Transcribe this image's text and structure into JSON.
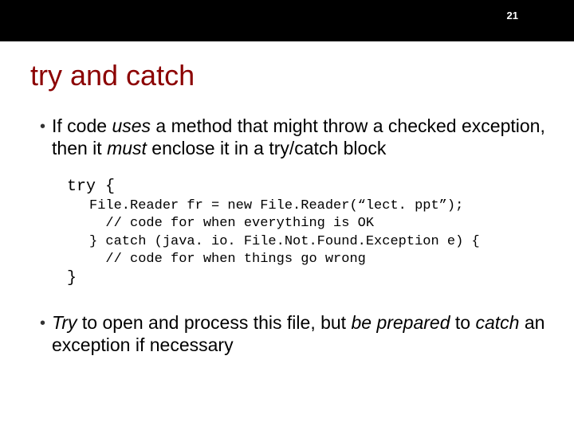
{
  "page_number": "21",
  "title": "try and catch",
  "bullet1": {
    "pre": "If code ",
    "uses": "uses",
    "mid1": " a method that might throw a checked exception, then it ",
    "must": "must",
    "mid2": " enclose it in a try/catch block"
  },
  "code": {
    "line_try": "try {",
    "line1": "File.Reader fr = new File.Reader(“lect. ppt”);",
    "line2": "  // code for when everything is OK",
    "line3": "} catch (java. io. File.Not.Found.Exception e) {",
    "line4": "  // code for when things go wrong",
    "line_close": "}"
  },
  "bullet2": {
    "try": "Try",
    "mid1": " to open and process this file, but ",
    "beprep": "be prepared",
    "mid2": " to ",
    "catch": "catch",
    "mid3": " an exception if necessary"
  }
}
